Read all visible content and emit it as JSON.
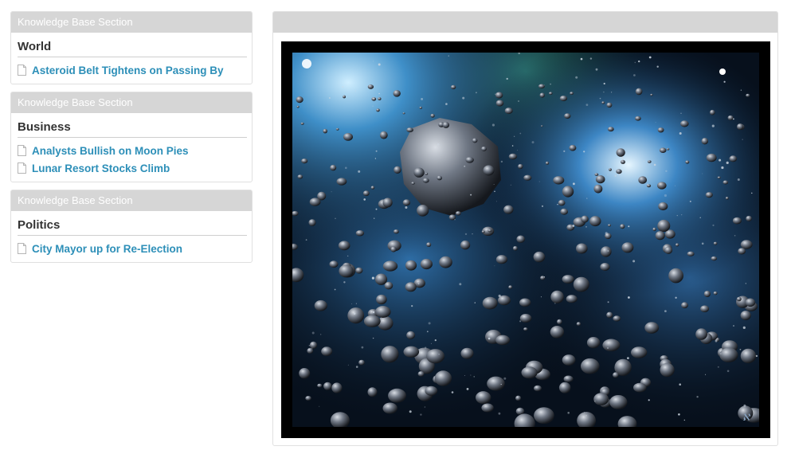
{
  "sections": [
    {
      "header": "Knowledge Base Section",
      "title": "World",
      "articles": [
        "Asteroid Belt Tightens on Passing By"
      ]
    },
    {
      "header": "Knowledge Base Section",
      "title": "Business",
      "articles": [
        "Analysts Bullish on Moon Pies",
        "Lunar Resort Stocks Climb"
      ]
    },
    {
      "header": "Knowledge Base Section",
      "title": "Politics",
      "articles": [
        "City Mayor up for Re-Election"
      ]
    }
  ],
  "main": {
    "header": "",
    "image": "asteroid-field-space-illustration"
  },
  "colors": {
    "link": "#2d8fb8",
    "panel_header": "#d6d6d6",
    "title_text": "#333333"
  },
  "icons": {
    "article": "document-icon"
  }
}
